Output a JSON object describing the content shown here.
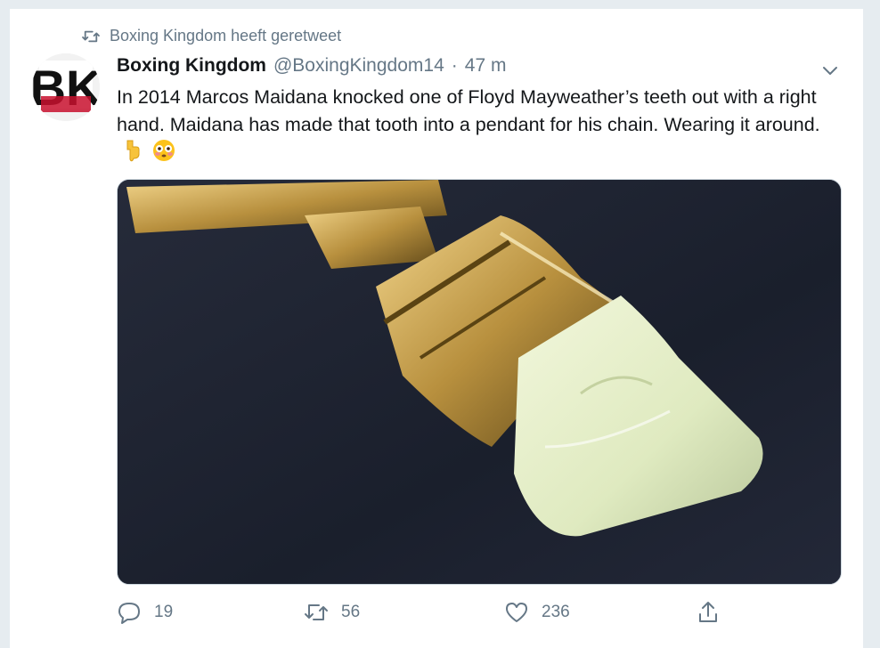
{
  "retweet": {
    "icon": "retweet-icon",
    "text": "Boxing Kingdom heeft geretweet"
  },
  "tweet": {
    "author_name": "Boxing Kingdom",
    "author_handle": "@BoxingKingdom14",
    "separator": "·",
    "time": "47 m",
    "avatar_text": "BK",
    "text": "In 2014 Marcos Maidana knocked one of Floyd Mayweather’s teeth out with a right hand. Maidana has made that tooth into a pendant for his chain. Wearing it around.",
    "emojis": [
      "point-down-emoji",
      "flushed-face-emoji"
    ]
  },
  "actions": {
    "reply_count": "19",
    "retweet_count": "56",
    "like_count": "236"
  },
  "colors": {
    "background": "#e6ecf0",
    "text": "#14171a",
    "muted": "#657786",
    "border": "#ccd6dd"
  }
}
